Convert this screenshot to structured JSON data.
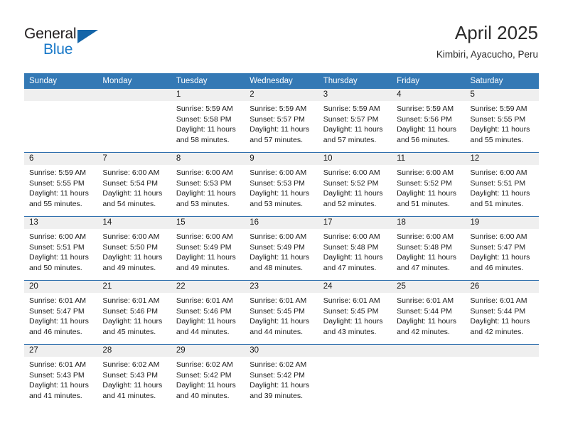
{
  "brand": {
    "name_top": "General",
    "name_bottom": "Blue",
    "accent_color": "#1878c8",
    "triangle_color": "#1565a8"
  },
  "header": {
    "title": "April 2025",
    "subtitle": "Kimbiri, Ayacucho, Peru"
  },
  "theme": {
    "header_blue": "#3479b5",
    "separator_blue": "#2f6fad",
    "number_band_gray": "#efefef",
    "text_color": "#1a1a1a"
  },
  "calendar": {
    "weekday_headers": [
      "Sunday",
      "Monday",
      "Tuesday",
      "Wednesday",
      "Thursday",
      "Friday",
      "Saturday"
    ],
    "weeks": [
      [
        {
          "day": "",
          "lines": []
        },
        {
          "day": "",
          "lines": []
        },
        {
          "day": "1",
          "lines": [
            "Sunrise: 5:59 AM",
            "Sunset: 5:58 PM",
            "Daylight: 11 hours",
            "and 58 minutes."
          ]
        },
        {
          "day": "2",
          "lines": [
            "Sunrise: 5:59 AM",
            "Sunset: 5:57 PM",
            "Daylight: 11 hours",
            "and 57 minutes."
          ]
        },
        {
          "day": "3",
          "lines": [
            "Sunrise: 5:59 AM",
            "Sunset: 5:57 PM",
            "Daylight: 11 hours",
            "and 57 minutes."
          ]
        },
        {
          "day": "4",
          "lines": [
            "Sunrise: 5:59 AM",
            "Sunset: 5:56 PM",
            "Daylight: 11 hours",
            "and 56 minutes."
          ]
        },
        {
          "day": "5",
          "lines": [
            "Sunrise: 5:59 AM",
            "Sunset: 5:55 PM",
            "Daylight: 11 hours",
            "and 55 minutes."
          ]
        }
      ],
      [
        {
          "day": "6",
          "lines": [
            "Sunrise: 5:59 AM",
            "Sunset: 5:55 PM",
            "Daylight: 11 hours",
            "and 55 minutes."
          ]
        },
        {
          "day": "7",
          "lines": [
            "Sunrise: 6:00 AM",
            "Sunset: 5:54 PM",
            "Daylight: 11 hours",
            "and 54 minutes."
          ]
        },
        {
          "day": "8",
          "lines": [
            "Sunrise: 6:00 AM",
            "Sunset: 5:53 PM",
            "Daylight: 11 hours",
            "and 53 minutes."
          ]
        },
        {
          "day": "9",
          "lines": [
            "Sunrise: 6:00 AM",
            "Sunset: 5:53 PM",
            "Daylight: 11 hours",
            "and 53 minutes."
          ]
        },
        {
          "day": "10",
          "lines": [
            "Sunrise: 6:00 AM",
            "Sunset: 5:52 PM",
            "Daylight: 11 hours",
            "and 52 minutes."
          ]
        },
        {
          "day": "11",
          "lines": [
            "Sunrise: 6:00 AM",
            "Sunset: 5:52 PM",
            "Daylight: 11 hours",
            "and 51 minutes."
          ]
        },
        {
          "day": "12",
          "lines": [
            "Sunrise: 6:00 AM",
            "Sunset: 5:51 PM",
            "Daylight: 11 hours",
            "and 51 minutes."
          ]
        }
      ],
      [
        {
          "day": "13",
          "lines": [
            "Sunrise: 6:00 AM",
            "Sunset: 5:51 PM",
            "Daylight: 11 hours",
            "and 50 minutes."
          ]
        },
        {
          "day": "14",
          "lines": [
            "Sunrise: 6:00 AM",
            "Sunset: 5:50 PM",
            "Daylight: 11 hours",
            "and 49 minutes."
          ]
        },
        {
          "day": "15",
          "lines": [
            "Sunrise: 6:00 AM",
            "Sunset: 5:49 PM",
            "Daylight: 11 hours",
            "and 49 minutes."
          ]
        },
        {
          "day": "16",
          "lines": [
            "Sunrise: 6:00 AM",
            "Sunset: 5:49 PM",
            "Daylight: 11 hours",
            "and 48 minutes."
          ]
        },
        {
          "day": "17",
          "lines": [
            "Sunrise: 6:00 AM",
            "Sunset: 5:48 PM",
            "Daylight: 11 hours",
            "and 47 minutes."
          ]
        },
        {
          "day": "18",
          "lines": [
            "Sunrise: 6:00 AM",
            "Sunset: 5:48 PM",
            "Daylight: 11 hours",
            "and 47 minutes."
          ]
        },
        {
          "day": "19",
          "lines": [
            "Sunrise: 6:00 AM",
            "Sunset: 5:47 PM",
            "Daylight: 11 hours",
            "and 46 minutes."
          ]
        }
      ],
      [
        {
          "day": "20",
          "lines": [
            "Sunrise: 6:01 AM",
            "Sunset: 5:47 PM",
            "Daylight: 11 hours",
            "and 46 minutes."
          ]
        },
        {
          "day": "21",
          "lines": [
            "Sunrise: 6:01 AM",
            "Sunset: 5:46 PM",
            "Daylight: 11 hours",
            "and 45 minutes."
          ]
        },
        {
          "day": "22",
          "lines": [
            "Sunrise: 6:01 AM",
            "Sunset: 5:46 PM",
            "Daylight: 11 hours",
            "and 44 minutes."
          ]
        },
        {
          "day": "23",
          "lines": [
            "Sunrise: 6:01 AM",
            "Sunset: 5:45 PM",
            "Daylight: 11 hours",
            "and 44 minutes."
          ]
        },
        {
          "day": "24",
          "lines": [
            "Sunrise: 6:01 AM",
            "Sunset: 5:45 PM",
            "Daylight: 11 hours",
            "and 43 minutes."
          ]
        },
        {
          "day": "25",
          "lines": [
            "Sunrise: 6:01 AM",
            "Sunset: 5:44 PM",
            "Daylight: 11 hours",
            "and 42 minutes."
          ]
        },
        {
          "day": "26",
          "lines": [
            "Sunrise: 6:01 AM",
            "Sunset: 5:44 PM",
            "Daylight: 11 hours",
            "and 42 minutes."
          ]
        }
      ],
      [
        {
          "day": "27",
          "lines": [
            "Sunrise: 6:01 AM",
            "Sunset: 5:43 PM",
            "Daylight: 11 hours",
            "and 41 minutes."
          ]
        },
        {
          "day": "28",
          "lines": [
            "Sunrise: 6:02 AM",
            "Sunset: 5:43 PM",
            "Daylight: 11 hours",
            "and 41 minutes."
          ]
        },
        {
          "day": "29",
          "lines": [
            "Sunrise: 6:02 AM",
            "Sunset: 5:42 PM",
            "Daylight: 11 hours",
            "and 40 minutes."
          ]
        },
        {
          "day": "30",
          "lines": [
            "Sunrise: 6:02 AM",
            "Sunset: 5:42 PM",
            "Daylight: 11 hours",
            "and 39 minutes."
          ]
        },
        {
          "day": "",
          "lines": []
        },
        {
          "day": "",
          "lines": []
        },
        {
          "day": "",
          "lines": []
        }
      ]
    ]
  }
}
